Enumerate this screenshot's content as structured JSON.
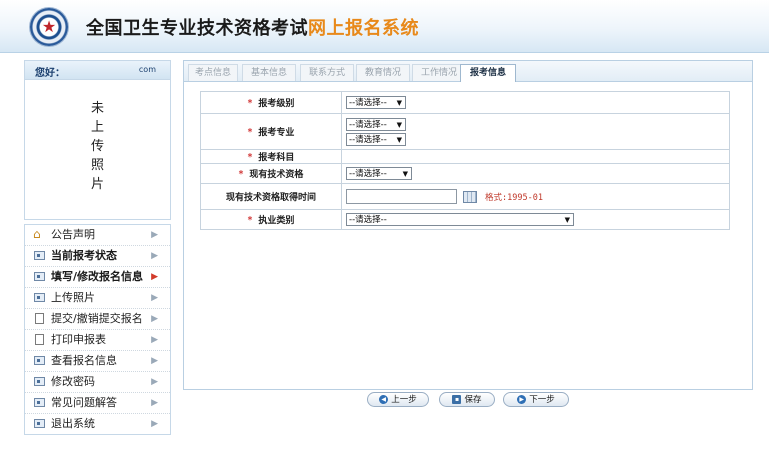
{
  "header": {
    "title_part1": "全国卫生专业技术资格考试",
    "title_part2": "网上报名系统",
    "title_accent_color": "#e8891a"
  },
  "sidebar": {
    "greeting": "您好：",
    "email_suffix": "com",
    "photo_placeholder": [
      "未",
      "上",
      "传",
      "照",
      "片"
    ],
    "menu": [
      {
        "label": "公告声明",
        "icon": "home-icon",
        "bold": false
      },
      {
        "label": "当前报考状态",
        "icon": "window-icon",
        "bold": true
      },
      {
        "label": "填写/修改报名信息",
        "icon": "window-icon",
        "bold": true,
        "active": true
      },
      {
        "label": "上传照片",
        "icon": "window-icon",
        "bold": false
      },
      {
        "label": "提交/撤销提交报名",
        "icon": "document-icon",
        "bold": false
      },
      {
        "label": "打印申报表",
        "icon": "document-icon",
        "bold": false
      },
      {
        "label": "查看报名信息",
        "icon": "window-icon",
        "bold": false
      },
      {
        "label": "修改密码",
        "icon": "window-icon",
        "bold": false
      },
      {
        "label": "常见问题解答",
        "icon": "window-icon",
        "bold": false
      },
      {
        "label": "退出系统",
        "icon": "window-icon",
        "bold": false
      }
    ]
  },
  "tabs": [
    {
      "label": "考点信息",
      "active": false
    },
    {
      "label": "基本信息",
      "active": false
    },
    {
      "label": "联系方式",
      "active": false
    },
    {
      "label": "教育情况",
      "active": false
    },
    {
      "label": "工作情况",
      "active": false
    },
    {
      "label": "报考信息",
      "active": true
    }
  ],
  "form": {
    "level_label": "报考级别",
    "level_value": "--请选择--",
    "major_label": "报考专业",
    "major_value_1": "--请选择--",
    "major_value_2": "--请选择--",
    "subject_label": "报考科目",
    "current_qual_label": "现有技术资格",
    "current_qual_value": "--请选择--",
    "qual_time_label": "现有技术资格取得时间",
    "qual_time_value": "",
    "format_hint": "格式:1995-01",
    "practice_label": "执业类别",
    "practice_value": "--请选择--",
    "required_mark": "*"
  },
  "buttons": {
    "prev": "上一步",
    "save": "保存",
    "next": "下一步"
  }
}
